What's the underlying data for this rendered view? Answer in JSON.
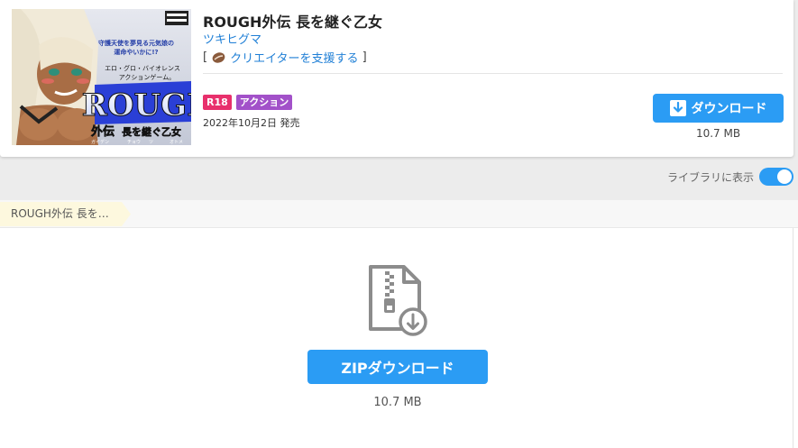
{
  "work": {
    "title": "ROUGH外伝 長を継ぐ乙女",
    "author": "ツキヒグマ",
    "support_open": "[",
    "support_link": "クリエイターを支援する",
    "support_close": "]",
    "support_icon": "coffee-bean-icon",
    "tags": [
      {
        "label": "R18",
        "color": "#e8306c"
      },
      {
        "label": "アクション",
        "color": "#a251c9"
      }
    ],
    "release": "2022年10月2日 発売",
    "download_label": "ダウンロード",
    "download_size": "10.7 MB"
  },
  "thumbnail": {
    "tagline_1": "守護天使を夢見る元気娘の",
    "tagline_2": "運命やいかに!?",
    "genre_text": "エロ・グロ・バイオレンス",
    "genre_text_2": "アクションゲーム。",
    "logo_big": "ROUGH",
    "logo_sub": "外伝",
    "logo_sub2": "長を継ぐ乙女",
    "ruby_1": "ガイデン",
    "ruby_2": "チョウ",
    "ruby_3": "ツ",
    "ruby_4": "オトメ"
  },
  "library": {
    "label": "ライブラリに表示",
    "enabled": true
  },
  "breadcrumb": "ROUGH外伝 長を…",
  "zip": {
    "button_label": "ZIPダウンロード",
    "size": "10.7 MB",
    "icon": "zip-file-download-icon"
  },
  "colors": {
    "accent": "#2b9cf4",
    "link": "#1f7fd6",
    "r18": "#e8306c",
    "genre": "#a251c9"
  }
}
